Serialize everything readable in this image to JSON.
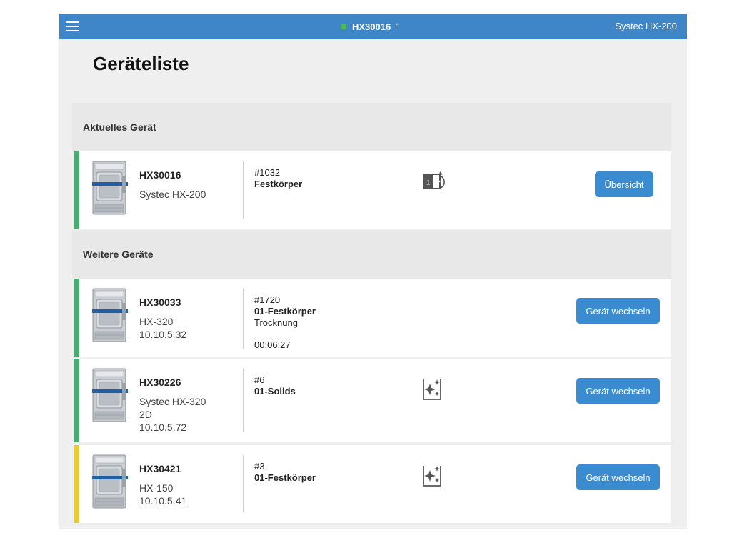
{
  "topbar": {
    "current_device": "HX30016",
    "model": "Systec HX-200",
    "status_color": "#4cbb57"
  },
  "page": {
    "title": "Geräteliste"
  },
  "current_section": {
    "header": "Aktuelles Gerät",
    "device": {
      "id": "HX30016",
      "lines": [
        "Systec HX-200"
      ],
      "program_no": "#1032",
      "program_name": "Festkörper",
      "icon": "program-one-cycle-icon",
      "button": "Übersicht",
      "status_color": "#4aac6e"
    }
  },
  "other_section": {
    "header": "Weitere Geräte",
    "devices": [
      {
        "id": "HX30033",
        "lines": [
          "HX-320",
          "10.10.5.32"
        ],
        "program_no": "#1720",
        "program_name": "01-Festkörper",
        "phase": "Trocknung",
        "time": "00:06:27",
        "button": "Gerät wechseln",
        "status_color": "#4aac6e"
      },
      {
        "id": "HX30226",
        "lines": [
          "Systec HX-320",
          "2D",
          "10.10.5.72"
        ],
        "program_no": "#6",
        "program_name": "01-Solids",
        "icon": "clean-sparkle-icon",
        "button": "Gerät wechseln",
        "status_color": "#4aac6e"
      },
      {
        "id": "HX30421",
        "lines": [
          "HX-150",
          "10.10.5.41"
        ],
        "program_no": "#3",
        "program_name": "01-Festkörper",
        "icon": "clean-sparkle-icon",
        "button": "Gerät wechseln",
        "status_color": "#e7c93a"
      }
    ]
  }
}
